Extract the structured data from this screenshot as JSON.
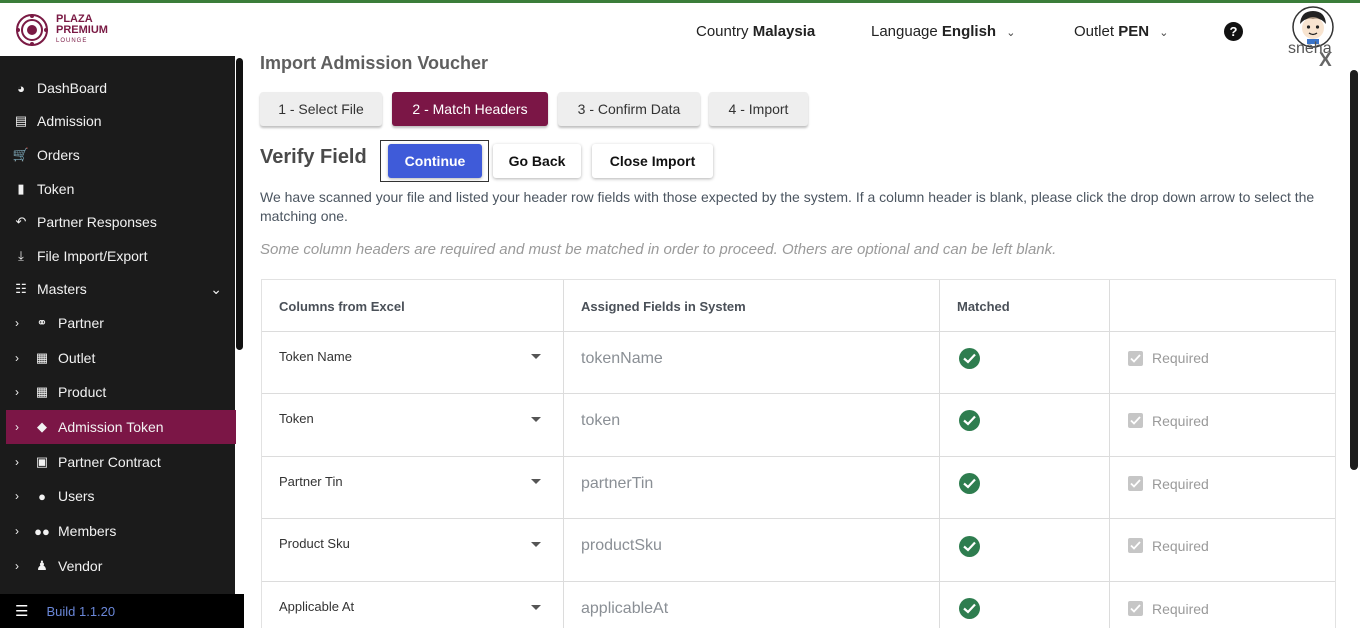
{
  "header": {
    "brand_line1": "PLAZA",
    "brand_line2": "PREMIUM",
    "brand_line3": "LOUNGE",
    "country_label": "Country",
    "country_value": "Malaysia",
    "language_label": "Language",
    "language_value": "English",
    "outlet_label": "Outlet",
    "outlet_value": "PEN",
    "help_glyph": "?",
    "user_name": "sneha"
  },
  "sidebar": {
    "items": [
      {
        "label": "DashBoard",
        "icon": "dashboard-icon"
      },
      {
        "label": "Admission",
        "icon": "id-card-icon"
      },
      {
        "label": "Orders",
        "icon": "cart-icon"
      },
      {
        "label": "Token",
        "icon": "file-icon"
      },
      {
        "label": "Partner Responses",
        "icon": "reply-icon"
      },
      {
        "label": "File Import/Export",
        "icon": "download-icon"
      },
      {
        "label": "Masters",
        "icon": "sitemap-icon"
      }
    ],
    "sub_items": [
      {
        "label": "Partner",
        "icon": "handshake-icon"
      },
      {
        "label": "Outlet",
        "icon": "building-icon"
      },
      {
        "label": "Product",
        "icon": "gift-icon"
      },
      {
        "label": "Admission Token",
        "icon": "ticket-icon",
        "active": true
      },
      {
        "label": "Partner Contract",
        "icon": "briefcase-icon"
      },
      {
        "label": "Users",
        "icon": "user-icon"
      },
      {
        "label": "Members",
        "icon": "users-icon"
      },
      {
        "label": "Vendor",
        "icon": "person-icon"
      }
    ],
    "build_label": "Build 1.1.20"
  },
  "main": {
    "title": "Import Admission Voucher",
    "close_label": "X",
    "steps": [
      "1 - Select File",
      "2 - Match Headers",
      "3 - Confirm Data",
      "4 - Import"
    ],
    "active_step": 2,
    "verify_title": "Verify Field",
    "continue_label": "Continue",
    "go_back_label": "Go Back",
    "close_import_label": "Close Import",
    "description": "We have scanned your file and listed your header row fields with those expected by the system. If a column header is blank, please click the drop down arrow to select the matching one.",
    "note": "Some column headers are required and must be matched in order to proceed. Others are optional and can be left blank."
  },
  "table": {
    "headers": [
      "Columns from Excel",
      "Assigned Fields in System",
      "Matched",
      ""
    ],
    "rows": [
      {
        "excel": "Token Name",
        "field": "tokenName",
        "matched": true,
        "required_label": "Required"
      },
      {
        "excel": "Token",
        "field": "token",
        "matched": true,
        "required_label": "Required"
      },
      {
        "excel": "Partner Tin",
        "field": "partnerTin",
        "matched": true,
        "required_label": "Required"
      },
      {
        "excel": "Product Sku",
        "field": "productSku",
        "matched": true,
        "required_label": "Required"
      },
      {
        "excel": "Applicable At",
        "field": "applicableAt",
        "matched": true,
        "required_label": "Required"
      }
    ]
  },
  "colors": {
    "brand": "#7b1646",
    "primary_button": "#3f5bd9",
    "sidebar_bg": "#1b1b1b",
    "matched_green": "#2e7d4f"
  }
}
